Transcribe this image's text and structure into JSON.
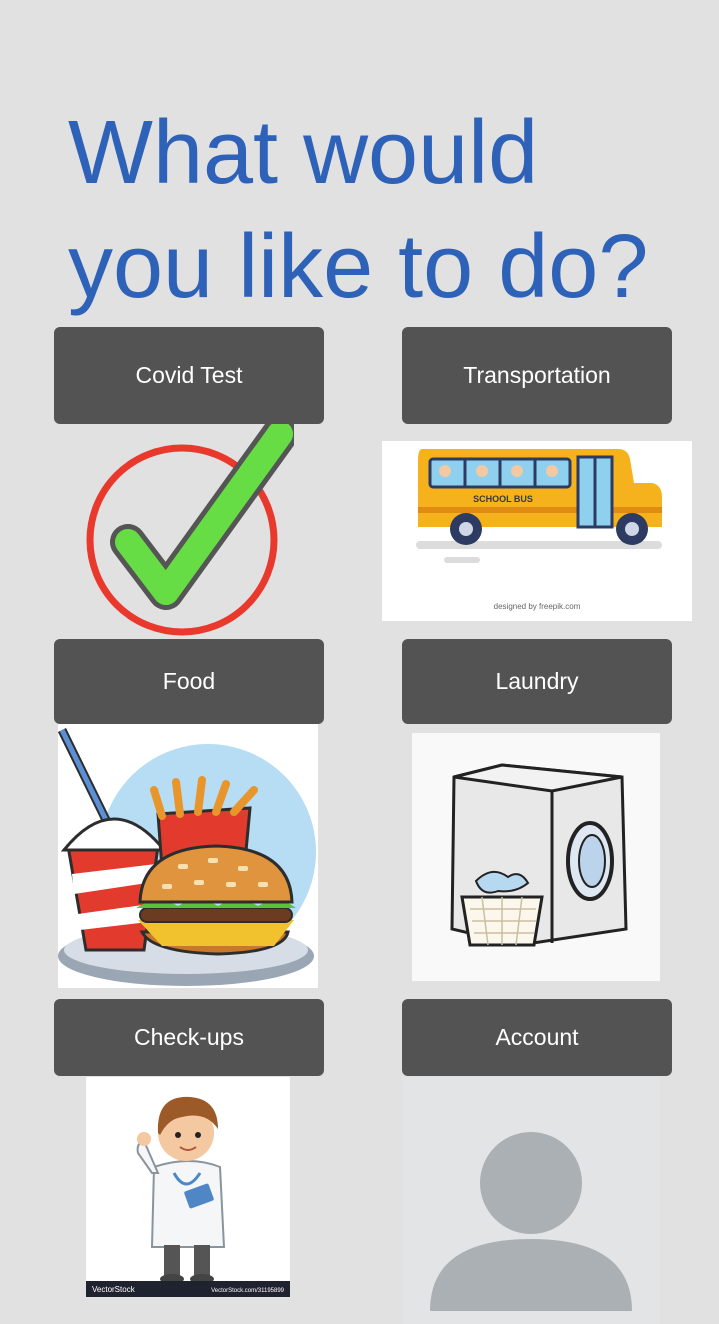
{
  "page": {
    "title": "What would you like to do?"
  },
  "menu": [
    {
      "id": "covid-test",
      "label": "Covid Test",
      "image_icon": "checkmark-in-circle-icon"
    },
    {
      "id": "transportation",
      "label": "Transportation",
      "image_icon": "school-bus-icon",
      "image_caption": "designed by freepik.com",
      "bus_sign": "SCHOOL BUS"
    },
    {
      "id": "food",
      "label": "Food",
      "image_icon": "fast-food-icon"
    },
    {
      "id": "laundry",
      "label": "Laundry",
      "image_icon": "washing-machine-icon"
    },
    {
      "id": "check-ups",
      "label": "Check-ups",
      "image_icon": "doctor-icon",
      "image_caption": "VectorStock",
      "image_caption_right": "VectorStock.com/31195899"
    },
    {
      "id": "account",
      "label": "Account",
      "image_icon": "user-avatar-icon"
    }
  ],
  "colors": {
    "background": "#e1e1e1",
    "title": "#2e62b8",
    "button": "#535353",
    "button_text": "#ffffff",
    "check_green": "#66dd44",
    "check_ring": "#e8392c",
    "bus_yellow": "#f6b21c",
    "avatar_gray": "#aab0b3"
  }
}
